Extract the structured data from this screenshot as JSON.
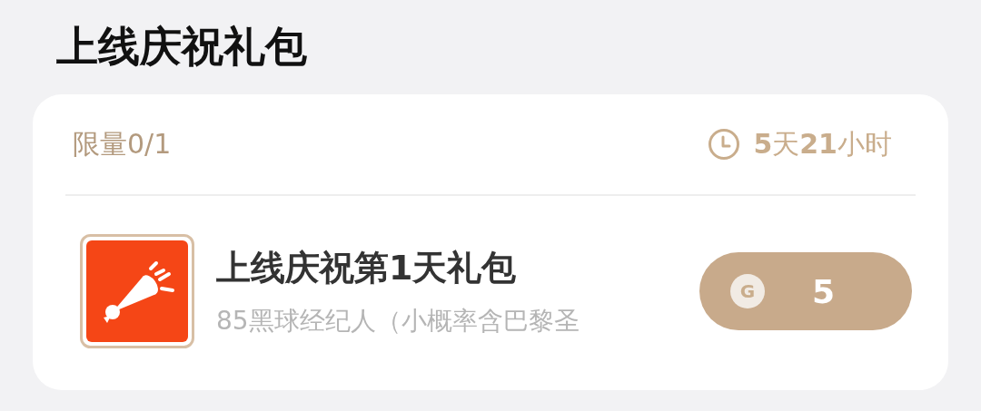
{
  "title": "上线庆祝礼包",
  "card": {
    "limit": "限量0/1",
    "countdown": "**5**天**21**小时",
    "item": {
      "name": "上线庆祝第1天礼包",
      "description": "85黑球经纪人（小概率含巴黎圣",
      "price": {
        "coin_symbol": "G",
        "amount": "5"
      }
    }
  }
}
